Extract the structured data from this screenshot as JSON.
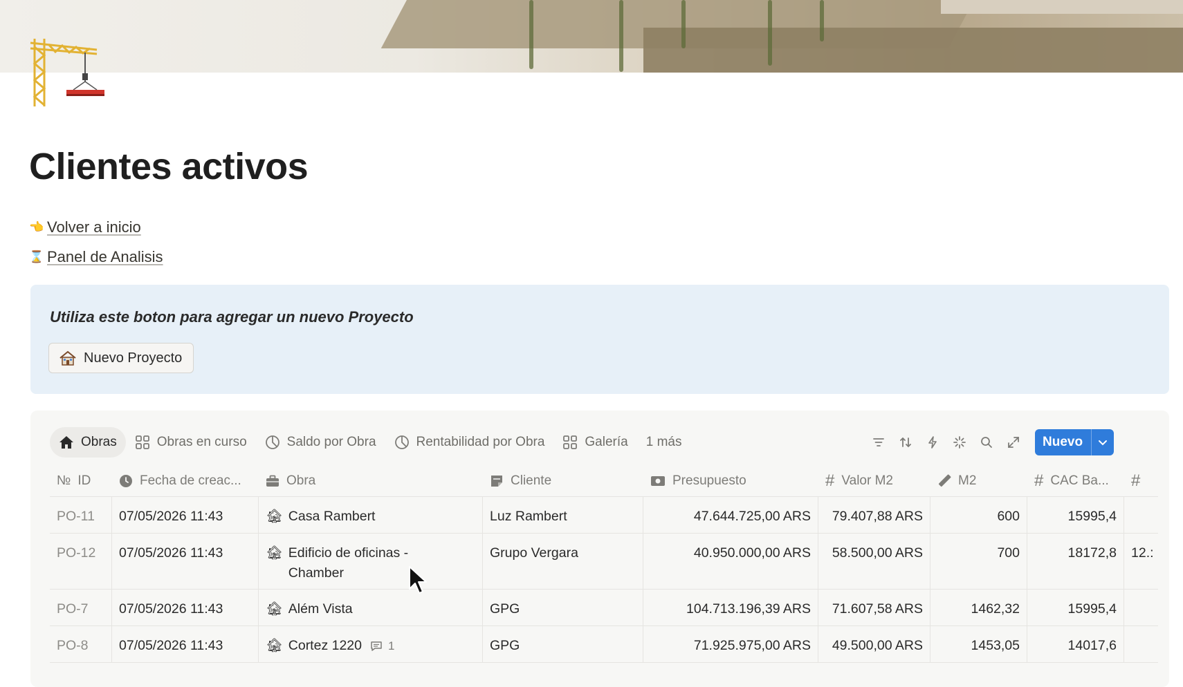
{
  "page": {
    "title": "Clientes activos",
    "links": [
      {
        "emoji": "👈",
        "label": "Volver a inicio"
      },
      {
        "emoji": "⌛",
        "label": "Panel de Analisis"
      }
    ]
  },
  "callout": {
    "text": "Utiliza este boton para agregar un nuevo Proyecto",
    "button_label": "Nuevo Proyecto"
  },
  "database": {
    "views": [
      {
        "icon": "home-icon",
        "label": "Obras",
        "active": true
      },
      {
        "icon": "gallery-icon",
        "label": "Obras en curso"
      },
      {
        "icon": "pie-chart-icon",
        "label": "Saldo por Obra"
      },
      {
        "icon": "pie-chart-icon",
        "label": "Rentabilidad por Obra"
      },
      {
        "icon": "gallery-icon",
        "label": "Galería"
      },
      {
        "label": "1 más"
      }
    ],
    "toolbar": [
      "filter-icon",
      "sort-icon",
      "automation-icon",
      "sparkle-icon",
      "search-icon",
      "expand-icon",
      "settings-icon"
    ],
    "new_button": "Nuevo",
    "columns": [
      {
        "icon": "№",
        "label": "ID"
      },
      {
        "icon": "clock-icon",
        "label": "Fecha de creac..."
      },
      {
        "icon": "briefcase-icon",
        "label": "Obra"
      },
      {
        "icon": "note-icon",
        "label": "Cliente"
      },
      {
        "icon": "money-icon",
        "label": "Presupuesto"
      },
      {
        "icon": "#",
        "label": "Valor M2"
      },
      {
        "icon": "ruler-icon",
        "label": "M2"
      },
      {
        "icon": "#",
        "label": "CAC Ba..."
      },
      {
        "icon": "#",
        "label": ""
      }
    ],
    "rows": [
      {
        "id": "PO-11",
        "fecha": "07/05/2026 11:43",
        "obra": "Casa Rambert",
        "cliente": "Luz Rambert",
        "presupuesto": "47.644.725,00 ARS",
        "valor_m2": "79.407,88 ARS",
        "m2": "600",
        "cac": "15995,4",
        "extra": ""
      },
      {
        "id": "PO-12",
        "fecha": "07/05/2026 11:43",
        "obra": "Edificio de oficinas - Chamber",
        "cliente": "Grupo Vergara",
        "presupuesto": "40.950.000,00 ARS",
        "valor_m2": "58.500,00 ARS",
        "m2": "700",
        "cac": "18172,8",
        "extra": "12.:"
      },
      {
        "id": "PO-7",
        "fecha": "07/05/2026 11:43",
        "obra": "Além Vista",
        "cliente": "GPG",
        "presupuesto": "104.713.196,39 ARS",
        "valor_m2": "71.607,58 ARS",
        "m2": "1462,32",
        "cac": "15995,4",
        "extra": ""
      },
      {
        "id": "PO-8",
        "fecha": "07/05/2026 11:43",
        "obra": "Cortez 1220",
        "comments": "1",
        "cliente": "GPG",
        "presupuesto": "71.925.975,00 ARS",
        "valor_m2": "49.500,00 ARS",
        "m2": "1453,05",
        "cac": "14017,6",
        "extra": ""
      }
    ]
  },
  "colors": {
    "accent": "#2f7cdb",
    "callout_bg": "#e7f0f8",
    "db_bg": "#f7f7f5"
  }
}
